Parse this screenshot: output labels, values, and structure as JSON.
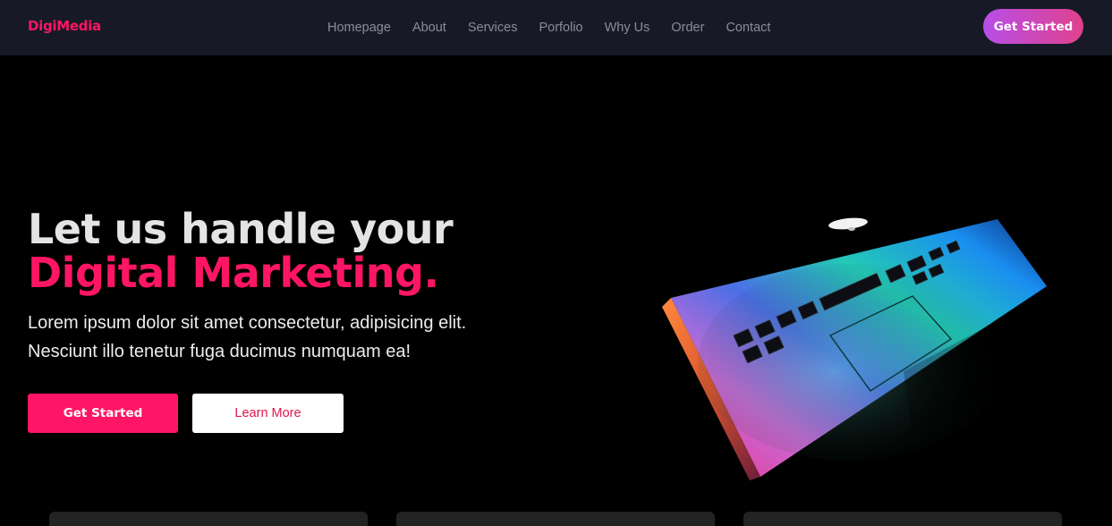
{
  "brand": {
    "logo": "DigiMedia"
  },
  "nav": {
    "links": [
      "Homepage",
      "About",
      "Services",
      "Porfolio",
      "Why Us",
      "Order",
      "Contact"
    ],
    "cta_label": "Get Started"
  },
  "hero": {
    "title_line1": "Let us handle your",
    "title_line2": "Digital Marketing.",
    "subtitle_line1": "Lorem ipsum dolor sit amet consectetur, adipisicing elit.",
    "subtitle_line2": "Nesciunt illo tenetur fuga ducimus numquam ea!",
    "primary_button": "Get Started",
    "secondary_button": "Learn More"
  },
  "colors": {
    "accent": "#ff1565",
    "nav_bg": "#171a26",
    "page_bg": "#000000",
    "cta_gradient_start": "#b84ee8",
    "cta_gradient_end": "#e0418c"
  }
}
